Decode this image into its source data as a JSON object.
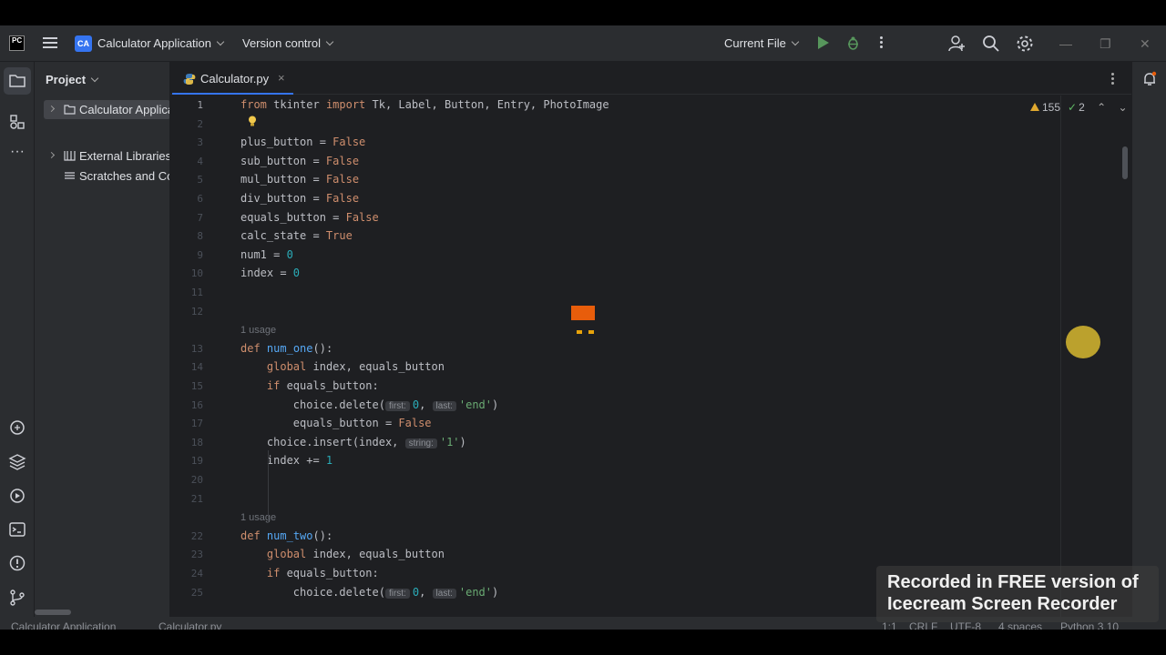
{
  "titlebar": {
    "app_logo": "PC",
    "project_badge": "CA",
    "project_name": "Calculator Application",
    "version_control": "Version control",
    "run_config": "Current File"
  },
  "project_panel": {
    "title": "Project",
    "items": [
      {
        "label": "Calculator Application",
        "icon": "folder-icon"
      },
      {
        "label": "External Libraries",
        "icon": "library-icon"
      },
      {
        "label": "Scratches and Consoles",
        "icon": "scratches-icon"
      }
    ]
  },
  "editor": {
    "tab_label": "Calculator.py",
    "inspections": {
      "warnings": "155",
      "checks": "2"
    },
    "lines": [
      {
        "n": "1",
        "code": [
          [
            "kw",
            "from"
          ],
          [
            "t",
            " tkinter "
          ],
          [
            "kw",
            "import"
          ],
          [
            "t",
            " Tk, Label, Button, Entry, PhotoImage"
          ]
        ]
      },
      {
        "n": "2",
        "code": []
      },
      {
        "n": "3",
        "code": [
          [
            "t",
            "plus_button = "
          ],
          [
            "kw",
            "False"
          ]
        ]
      },
      {
        "n": "4",
        "code": [
          [
            "t",
            "sub_button = "
          ],
          [
            "kw",
            "False"
          ]
        ]
      },
      {
        "n": "5",
        "code": [
          [
            "t",
            "mul_button = "
          ],
          [
            "kw",
            "False"
          ]
        ]
      },
      {
        "n": "6",
        "code": [
          [
            "t",
            "div_button = "
          ],
          [
            "kw",
            "False"
          ]
        ]
      },
      {
        "n": "7",
        "code": [
          [
            "t",
            "equals_button = "
          ],
          [
            "kw",
            "False"
          ]
        ]
      },
      {
        "n": "8",
        "code": [
          [
            "t",
            "calc_state = "
          ],
          [
            "kw",
            "True"
          ]
        ]
      },
      {
        "n": "9",
        "code": [
          [
            "t",
            "num1 = "
          ],
          [
            "num",
            "0"
          ]
        ]
      },
      {
        "n": "10",
        "code": [
          [
            "t",
            "index = "
          ],
          [
            "num",
            "0"
          ]
        ]
      },
      {
        "n": "11",
        "code": []
      },
      {
        "n": "12",
        "code": []
      },
      {
        "n": "13",
        "usage": "1 usage",
        "code": [
          [
            "kw",
            "def"
          ],
          [
            "t",
            " "
          ],
          [
            "fn",
            "num_one"
          ],
          [
            "t",
            "():"
          ]
        ]
      },
      {
        "n": "14",
        "code": [
          [
            "t",
            "    "
          ],
          [
            "kw",
            "global"
          ],
          [
            "t",
            " index, equals_button"
          ]
        ]
      },
      {
        "n": "15",
        "code": [
          [
            "t",
            "    "
          ],
          [
            "kw",
            "if"
          ],
          [
            "t",
            " equals_button:"
          ]
        ]
      },
      {
        "n": "16",
        "code": [
          [
            "t",
            "        choice.delete("
          ],
          [
            "hint",
            "first:"
          ],
          [
            "num",
            "0"
          ],
          [
            "t",
            ", "
          ],
          [
            "hint",
            "last:"
          ],
          [
            "str",
            "'end'"
          ],
          [
            "t",
            ")"
          ]
        ]
      },
      {
        "n": "17",
        "code": [
          [
            "t",
            "        equals_button = "
          ],
          [
            "kw",
            "False"
          ]
        ]
      },
      {
        "n": "18",
        "code": [
          [
            "t",
            "    choice.insert(index, "
          ],
          [
            "hint",
            "string:"
          ],
          [
            "str",
            "'1'"
          ],
          [
            "t",
            ")"
          ]
        ]
      },
      {
        "n": "19",
        "code": [
          [
            "t",
            "    index += "
          ],
          [
            "num",
            "1"
          ]
        ]
      },
      {
        "n": "20",
        "code": []
      },
      {
        "n": "21",
        "code": []
      },
      {
        "n": "22",
        "usage": "1 usage",
        "code": [
          [
            "kw",
            "def"
          ],
          [
            "t",
            " "
          ],
          [
            "fn",
            "num_two"
          ],
          [
            "t",
            "():"
          ]
        ]
      },
      {
        "n": "23",
        "code": [
          [
            "t",
            "    "
          ],
          [
            "kw",
            "global"
          ],
          [
            "t",
            " index, equals_button"
          ]
        ]
      },
      {
        "n": "24",
        "code": [
          [
            "t",
            "    "
          ],
          [
            "kw",
            "if"
          ],
          [
            "t",
            " equals_button:"
          ]
        ]
      },
      {
        "n": "25",
        "code": [
          [
            "t",
            "        choice.delete("
          ],
          [
            "hint",
            "first:"
          ],
          [
            "num",
            "0"
          ],
          [
            "t",
            ", "
          ],
          [
            "hint",
            "last:"
          ],
          [
            "str",
            "'end'"
          ],
          [
            "t",
            ")"
          ]
        ]
      }
    ]
  },
  "statusbar": {
    "breadcrumb_project": "Calculator Application",
    "breadcrumb_file": "Calculator.py",
    "position": "1:1",
    "line_sep": "CRLF",
    "encoding": "UTF-8",
    "indent": "4 spaces",
    "interpreter": "Python 3.10"
  },
  "watermark": {
    "line1": "Recorded in FREE version of",
    "line2": "Icecream   Screen   Recorder"
  },
  "colors": {
    "accent": "#3574f0",
    "keyword": "#cf8e6d",
    "number": "#2aacb8",
    "string": "#6aab73",
    "function": "#56a8f5"
  }
}
